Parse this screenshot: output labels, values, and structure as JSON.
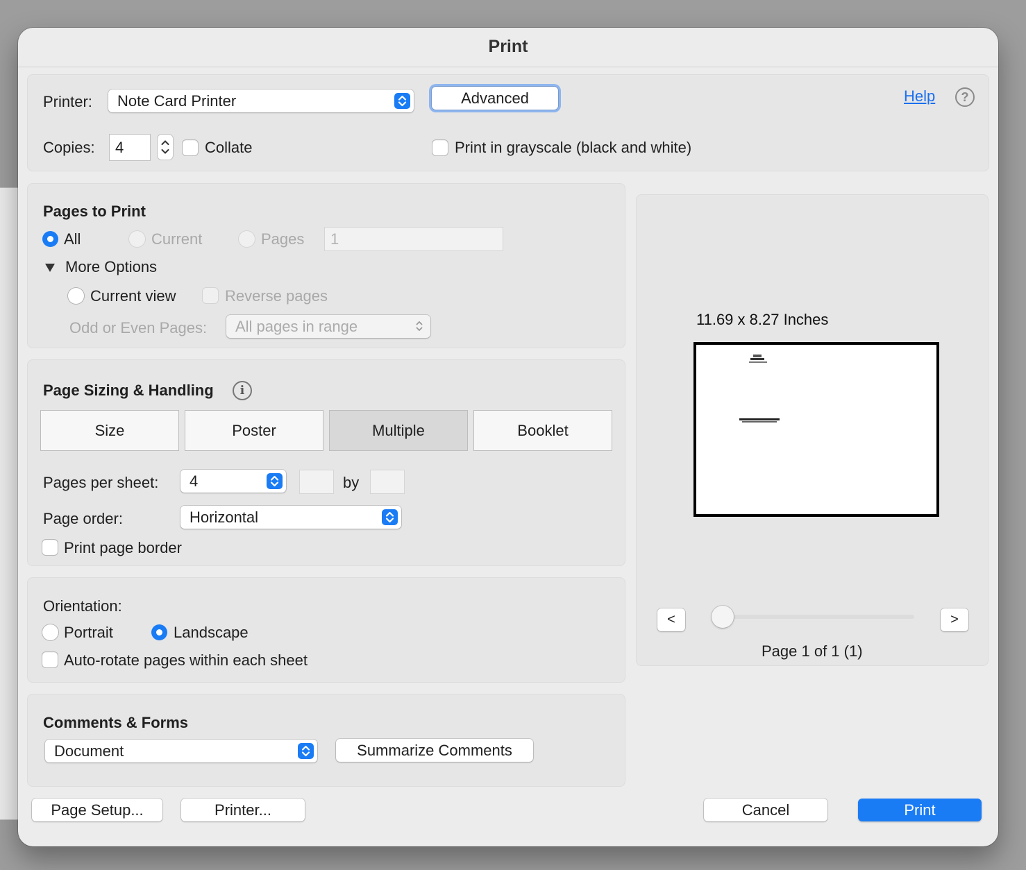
{
  "window": {
    "title": "Print"
  },
  "printer": {
    "label": "Printer:",
    "selected": "Note Card Printer",
    "advanced_label": "Advanced",
    "help_label": "Help",
    "help_icon": "?",
    "copies_label": "Copies:",
    "copies_value": "4",
    "collate_label": "Collate",
    "collate_checked": false,
    "grayscale_label": "Print in grayscale (black and white)",
    "grayscale_checked": false
  },
  "pages_to_print": {
    "heading": "Pages to Print",
    "all_label": "All",
    "current_label": "Current",
    "pages_label": "Pages",
    "pages_value": "1",
    "selected": "All",
    "more_options_label": "More Options",
    "current_view_label": "Current view",
    "reverse_pages_label": "Reverse pages",
    "odd_even_label": "Odd or Even Pages:",
    "odd_even_value": "All pages in range"
  },
  "page_sizing": {
    "heading": "Page Sizing & Handling",
    "info_icon": "i",
    "tabs": [
      "Size",
      "Poster",
      "Multiple",
      "Booklet"
    ],
    "active_tab": "Multiple",
    "pages_per_sheet_label": "Pages per sheet:",
    "pages_per_sheet_value": "4",
    "by_label": "by",
    "page_order_label": "Page order:",
    "page_order_value": "Horizontal",
    "print_border_label": "Print page border",
    "print_border_checked": false
  },
  "orientation": {
    "label": "Orientation:",
    "portrait_label": "Portrait",
    "landscape_label": "Landscape",
    "selected": "Landscape",
    "auto_rotate_label": "Auto-rotate pages within each sheet",
    "auto_rotate_checked": false
  },
  "comments_forms": {
    "heading": "Comments & Forms",
    "selected": "Document",
    "summarize_label": "Summarize Comments"
  },
  "preview": {
    "size_label": "11.69 x 8.27 Inches",
    "prev_label": "<",
    "next_label": ">",
    "page_status": "Page 1 of 1 (1)",
    "slider_position": 0
  },
  "footer": {
    "page_setup_label": "Page Setup...",
    "printer_label": "Printer...",
    "cancel_label": "Cancel",
    "print_label": "Print"
  },
  "colors": {
    "accent": "#1a7cf5",
    "link": "#1a6ff0",
    "window_bg": "#ececec"
  }
}
